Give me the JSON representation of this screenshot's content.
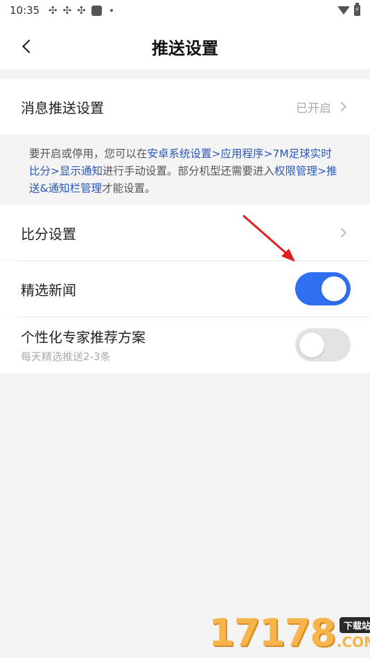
{
  "status_bar": {
    "time": "10:35",
    "left_icons": [
      "app-icon",
      "app-icon",
      "app-icon",
      "square-icon",
      "dot-icon"
    ],
    "right_icons": [
      "wifi-icon",
      "battery-charging-icon"
    ]
  },
  "header": {
    "back_icon": "chevron-left-icon",
    "title": "推送设置"
  },
  "push_row": {
    "label": "消息推送设置",
    "value": "已开启"
  },
  "notice": {
    "text_1": "要开启或停用，您可以在",
    "link_1": "安卓系统设置>应用程序>7M足球实时比分>显示通知",
    "text_2": "进行手动设置。部分机型还需要进入",
    "link_2": "权限管理>推送&通知栏管理",
    "text_3": "才能设置。",
    "link_color": "#2757b8"
  },
  "score_row": {
    "label": "比分设置"
  },
  "news_row": {
    "label": "精选新闻",
    "toggle_on": true
  },
  "expert_row": {
    "label": "个性化专家推荐方案",
    "sub": "每天精选推送2-3条",
    "toggle_on": false
  },
  "colors": {
    "accent": "#2f6ff0",
    "annotation_arrow": "#e02020"
  },
  "watermark": {
    "digits": "17178",
    "tag": "下载站",
    "com": ".COM"
  }
}
